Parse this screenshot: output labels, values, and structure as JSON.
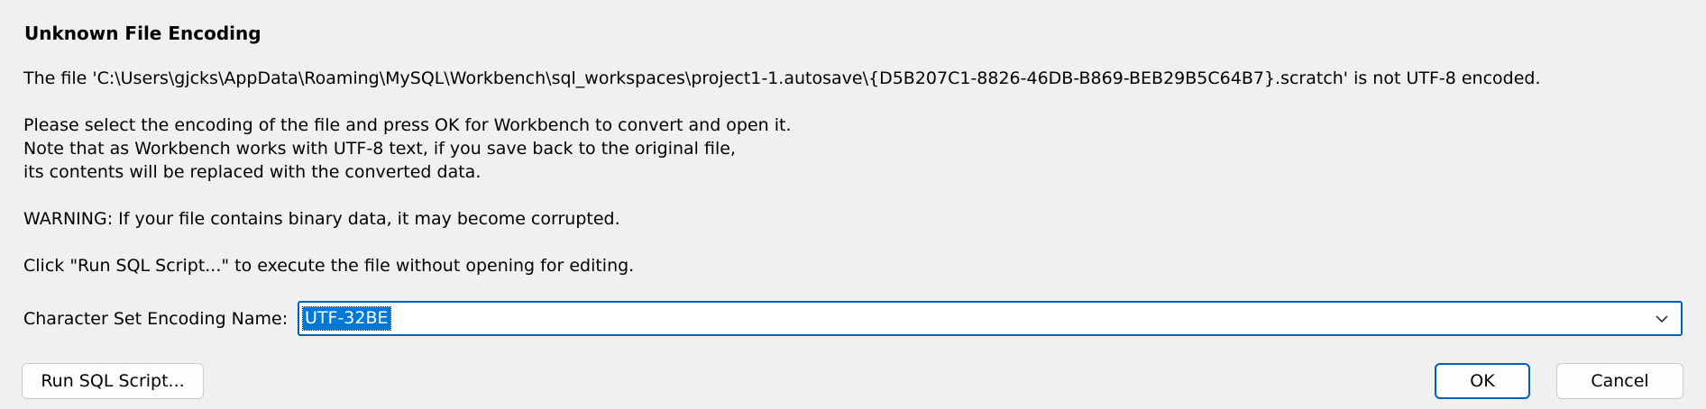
{
  "dialog": {
    "title": "Unknown File Encoding",
    "lines": [
      "The file 'C:\\Users\\gjcks\\AppData\\Roaming\\MySQL\\Workbench\\sql_workspaces\\project1-1.autosave\\{D5B207C1-8826-46DB-B869-BEB29B5C64B7}.scratch' is not UTF-8 encoded.",
      "Please select the encoding of the file and press OK for Workbench to convert and open it.",
      "Note that as Workbench works with UTF-8 text, if you save back to the original file,",
      "its contents will be replaced with the converted data.",
      "WARNING: If your file contains binary data, it may become corrupted.",
      "Click \"Run SQL Script...\" to execute the file without opening for editing."
    ],
    "encoding_label": "Character Set Encoding Name:",
    "encoding_value": "UTF-32BE",
    "buttons": {
      "run_script": "Run SQL Script...",
      "ok": "OK",
      "cancel": "Cancel"
    }
  },
  "colors": {
    "background": "#f0f0f0",
    "accent": "#005fb8",
    "selection": "#0078d7"
  },
  "icons": {
    "combo_dropdown": "chevron-down-icon"
  }
}
